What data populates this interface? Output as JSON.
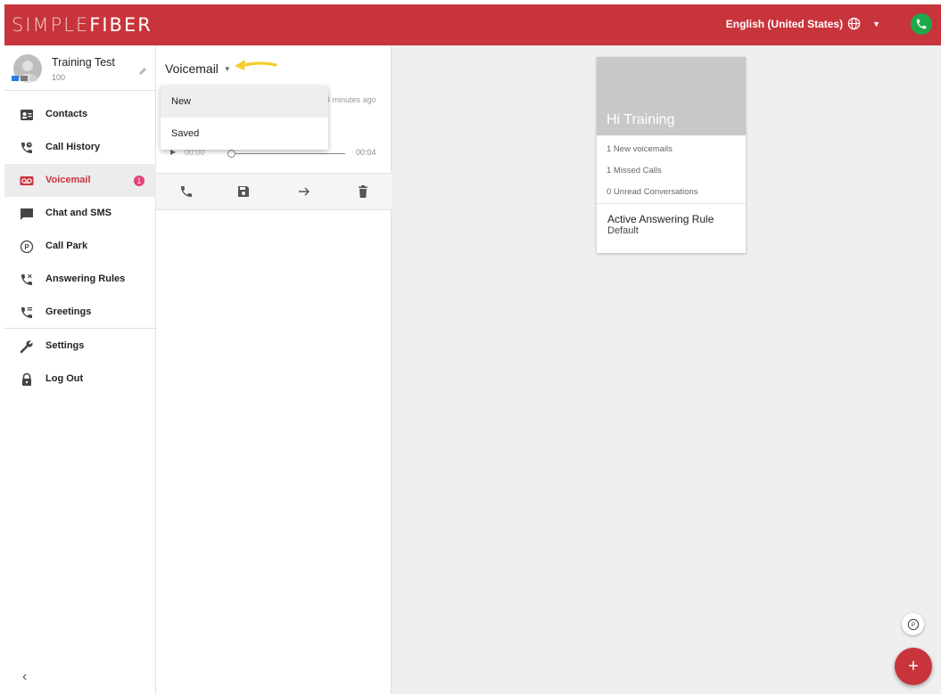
{
  "app": {
    "brand_part1": "SIMPLE",
    "brand_part2": "FIBER",
    "language": "English (United States)",
    "accent_color": "#c8343b",
    "status_color": "#1fa84a"
  },
  "profile": {
    "name": "Training Test",
    "extension": "100"
  },
  "sidebar": {
    "items": [
      {
        "label": "Contacts",
        "icon": "contacts-icon"
      },
      {
        "label": "Call History",
        "icon": "call-history-icon"
      },
      {
        "label": "Voicemail",
        "icon": "voicemail-icon",
        "badge": "1",
        "active": true
      },
      {
        "label": "Chat and SMS",
        "icon": "chat-icon"
      },
      {
        "label": "Call Park",
        "icon": "call-park-icon"
      },
      {
        "label": "Answering Rules",
        "icon": "answering-rules-icon"
      },
      {
        "label": "Greetings",
        "icon": "greetings-icon"
      },
      {
        "label": "Settings",
        "icon": "wrench-icon"
      },
      {
        "label": "Log Out",
        "icon": "lock-icon"
      }
    ],
    "collapse": "‹"
  },
  "voicemail": {
    "title": "Voicemail",
    "time_ago": "3 minutes ago",
    "position": "00:00",
    "duration": "00:04",
    "progress": 0,
    "dropdown": [
      "New",
      "Saved"
    ],
    "selected": "New"
  },
  "card": {
    "greeting": "Hi Training",
    "stats": [
      "1 New voicemails",
      "1 Missed Calls",
      "0 Unread Conversations"
    ],
    "rule_label": "Active Answering Rule",
    "rule_value": "Default"
  },
  "fab": {
    "add": "+",
    "park": "P"
  }
}
